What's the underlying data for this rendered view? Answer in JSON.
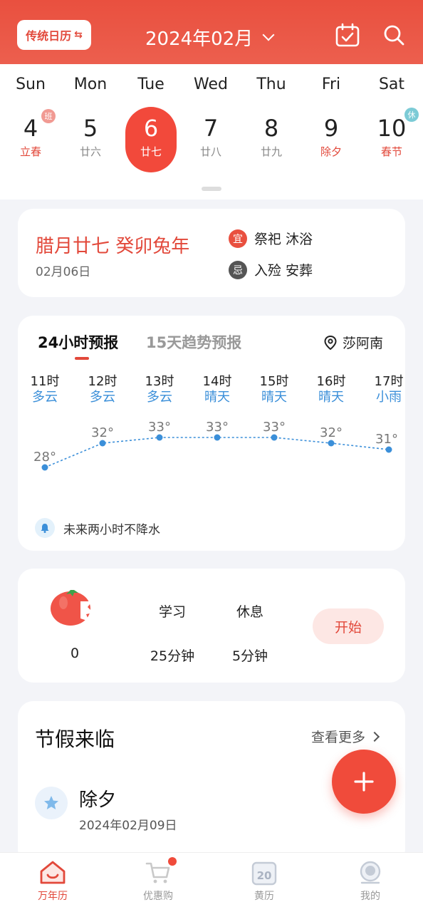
{
  "header": {
    "calendar_toggle": "传统日历",
    "month_title": "2024年02月"
  },
  "week": {
    "weekdays": [
      "Sun",
      "Mon",
      "Tue",
      "Wed",
      "Thu",
      "Fri",
      "Sat"
    ],
    "days": [
      {
        "num": "4",
        "lunar": "立春",
        "badge": "班"
      },
      {
        "num": "5",
        "lunar": "廿六"
      },
      {
        "num": "6",
        "lunar": "廿七"
      },
      {
        "num": "7",
        "lunar": "廿八"
      },
      {
        "num": "8",
        "lunar": "廿九"
      },
      {
        "num": "9",
        "lunar": "除夕"
      },
      {
        "num": "10",
        "lunar": "春节",
        "badge": "休"
      }
    ]
  },
  "almanac": {
    "lunar_date": "腊月廿七 癸卯兔年",
    "solar_date": "02月06日",
    "yi_tag": "宜",
    "yi_text": "祭祀 沐浴",
    "ji_tag": "忌",
    "ji_text": "入殓 安葬"
  },
  "weather": {
    "tab_active": "24小时预报",
    "tab_inactive": "15天趋势预报",
    "location": "莎阿南",
    "hours": [
      {
        "time": "11时",
        "cond": "多云",
        "temp": "28°"
      },
      {
        "time": "12时",
        "cond": "多云",
        "temp": "32°"
      },
      {
        "time": "13时",
        "cond": "多云",
        "temp": "33°"
      },
      {
        "time": "14时",
        "cond": "晴天",
        "temp": "33°"
      },
      {
        "time": "15时",
        "cond": "晴天",
        "temp": "33°"
      },
      {
        "time": "16时",
        "cond": "晴天",
        "temp": "32°"
      },
      {
        "time": "17时",
        "cond": "小雨",
        "temp": "31°"
      }
    ],
    "rain_note": "未来两小时不降水"
  },
  "focus": {
    "count": "0",
    "study_label": "学习",
    "study_value": "25分钟",
    "rest_label": "休息",
    "rest_value": "5分钟",
    "start_label": "开始"
  },
  "holiday": {
    "title": "节假来临",
    "see_more": "查看更多",
    "item_name": "除夕",
    "item_date": "2024年02月09日"
  },
  "nav": {
    "items": [
      "万年历",
      "优惠购",
      "黄历",
      "我的"
    ],
    "calendar_icon_number": "20"
  },
  "colors": {
    "brand_red": "#e9503f",
    "weather_blue": "#3b8fd9"
  }
}
